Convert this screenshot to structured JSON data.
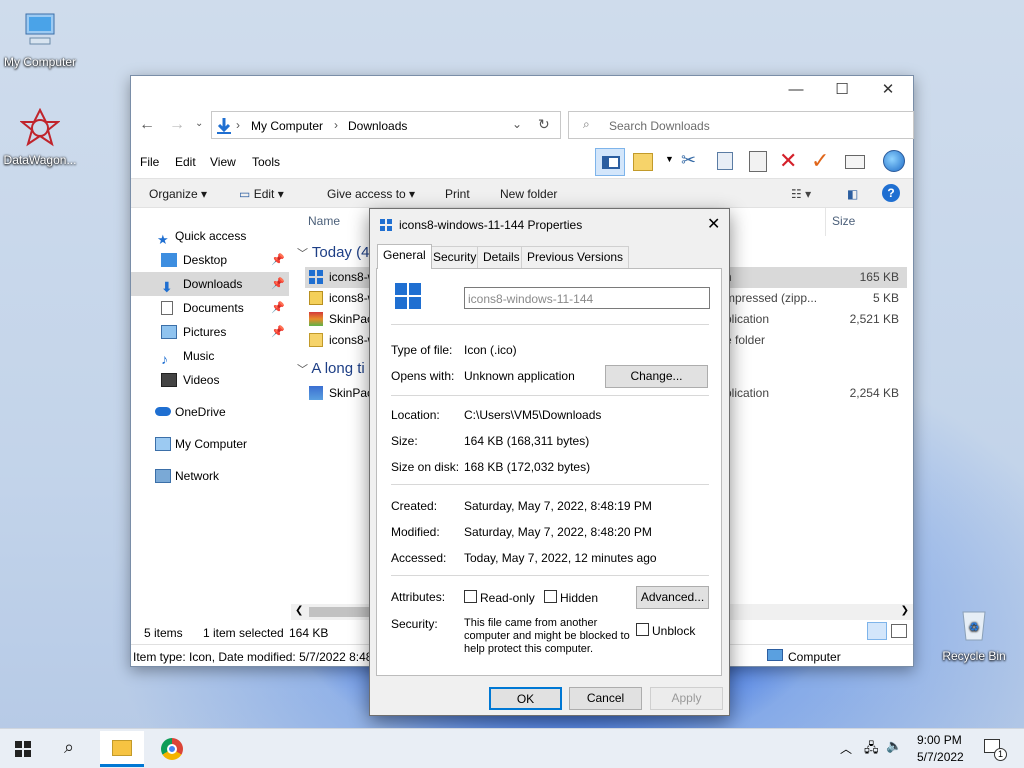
{
  "desktop": {
    "icons": [
      {
        "label": "My Computer"
      },
      {
        "label": "DataWagon..."
      },
      {
        "label": "Recycle Bin"
      }
    ]
  },
  "explorer": {
    "address": {
      "crumbs": [
        "My Computer",
        "Downloads"
      ]
    },
    "search": {
      "placeholder": "Search Downloads"
    },
    "menu": [
      "File",
      "Edit",
      "View",
      "Tools"
    ],
    "commands": {
      "organize": "Organize",
      "edit": "Edit",
      "give_access": "Give access to",
      "print": "Print",
      "new_folder": "New folder"
    },
    "columns": {
      "name": "Name",
      "size": "Size"
    },
    "nav": [
      {
        "label": "Quick access"
      },
      {
        "label": "Desktop"
      },
      {
        "label": "Downloads"
      },
      {
        "label": "Documents"
      },
      {
        "label": "Pictures"
      },
      {
        "label": "Music"
      },
      {
        "label": "Videos"
      },
      {
        "label": "OneDrive"
      },
      {
        "label": "My Computer"
      },
      {
        "label": "Network"
      }
    ],
    "groups": {
      "today": "Today (4",
      "long_time": "A long ti"
    },
    "rows": [
      {
        "name": "icons8-w",
        "type": "n",
        "size": "165 KB"
      },
      {
        "name": "icons8-w",
        "type": "mpressed (zipp...",
        "size": "5 KB"
      },
      {
        "name": "SkinPac",
        "type": "plication",
        "size": "2,521 KB"
      },
      {
        "name": "icons8-w",
        "type": "e folder",
        "size": ""
      },
      {
        "name": "SkinPac",
        "type": "plication",
        "size": "2,254 KB"
      }
    ],
    "status": {
      "items": "5 items",
      "selected": "1 item selected",
      "selected_size": "164 KB"
    },
    "details_bar": {
      "text": "Item type: Icon, Date modified: 5/7/2022 8:48",
      "location": "Computer"
    }
  },
  "dialog": {
    "title": "icons8-windows-11-144 Properties",
    "tabs": [
      "General",
      "Security",
      "Details",
      "Previous Versions"
    ],
    "filename": "icons8-windows-11-144",
    "type_label": "Type of file:",
    "type_value": "Icon (.ico)",
    "opens_label": "Opens with:",
    "opens_value": "Unknown application",
    "change_btn": "Change...",
    "location_label": "Location:",
    "location_value": "C:\\Users\\VM5\\Downloads",
    "size_label": "Size:",
    "size_value": "164 KB (168,311 bytes)",
    "disk_label": "Size on disk:",
    "disk_value": "168 KB (172,032 bytes)",
    "created_label": "Created:",
    "created_value": "Saturday, May 7, 2022, 8:48:19 PM",
    "modified_label": "Modified:",
    "modified_value": "Saturday, May 7, 2022, 8:48:20 PM",
    "accessed_label": "Accessed:",
    "accessed_value": "Today, May 7, 2022, 12 minutes ago",
    "attributes_label": "Attributes:",
    "readonly": "Read-only",
    "hidden": "Hidden",
    "advanced_btn": "Advanced...",
    "security_label": "Security:",
    "security_text": [
      "This file came from another",
      "computer and might be blocked to",
      "help protect this computer."
    ],
    "unblock": "Unblock",
    "ok": "OK",
    "cancel": "Cancel",
    "apply": "Apply"
  },
  "taskbar": {
    "time": "9:00 PM",
    "date": "5/7/2022",
    "notif_count": "1"
  },
  "colors": {
    "accent": "#0078d4",
    "selection": "#cce8ff",
    "selected_gray": "#d9d9d9"
  }
}
